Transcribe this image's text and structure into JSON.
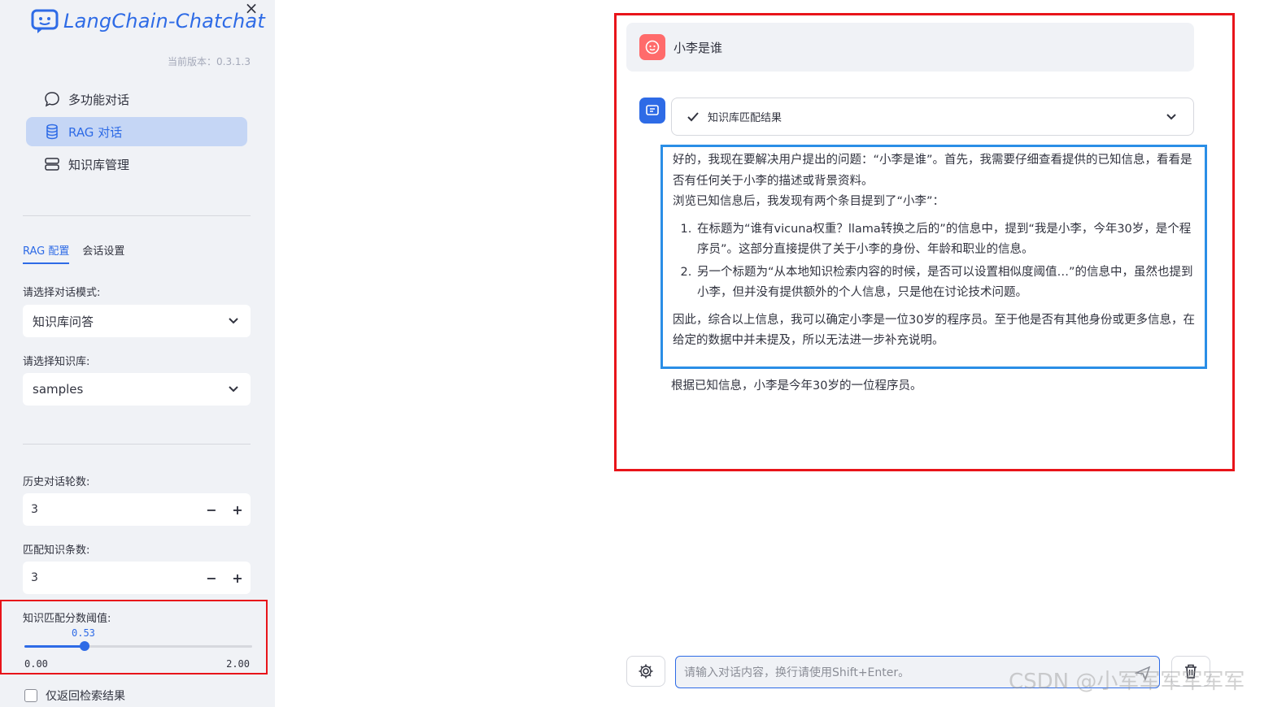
{
  "app": {
    "logo_text": "LangChain-Chatchat",
    "version": "当前版本：0.3.1.3",
    "close_icon": "close-icon"
  },
  "nav": {
    "items": [
      {
        "label": "多功能对话",
        "icon": "chat-bubble-icon",
        "active": false
      },
      {
        "label": "RAG 对话",
        "icon": "database-icon",
        "active": true
      },
      {
        "label": "知识库管理",
        "icon": "server-icon",
        "active": false
      }
    ]
  },
  "tabs": [
    {
      "label": "RAG 配置",
      "active": true
    },
    {
      "label": "会话设置",
      "active": false
    }
  ],
  "config": {
    "mode_label": "请选择对话模式:",
    "mode_value": "知识库问答",
    "kb_label": "请选择知识库:",
    "kb_value": "samples",
    "history_label": "历史对话轮数:",
    "history_value": "3",
    "topk_label": "匹配知识条数:",
    "topk_value": "3",
    "threshold_label": "知识匹配分数阈值:",
    "threshold_value": "0.53",
    "threshold_min": "0.00",
    "threshold_max": "2.00",
    "threshold_fraction": 0.265,
    "checkbox_label": "仅返回检索结果",
    "minus": "−",
    "plus": "+"
  },
  "chat": {
    "user_message": "小李是谁",
    "expander_label": "知识库匹配结果",
    "think": {
      "p1": "好的，我现在要解决用户提出的问题：“小李是谁”。首先，我需要仔细查看提供的已知信息，看看是否有任何关于小李的描述或背景资料。",
      "p2": "浏览已知信息后，我发现有两个条目提到了“小李”：",
      "items": [
        "在标题为“谁有vicuna权重？llama转换之后的”的信息中，提到“我是小李，今年30岁，是个程序员”。这部分直接提供了关于小李的身份、年龄和职业的信息。",
        "另一个标题为“从本地知识检索内容的时候，是否可以设置相似度阈值…”的信息中，虽然也提到小李，但并没有提供额外的个人信息，只是他在讨论技术问题。"
      ],
      "p3": "因此，综合以上信息，我可以确定小李是一位30岁的程序员。至于他是否有其他身份或更多信息，在给定的数据中并未提及，所以无法进一步补充说明。"
    },
    "answer": "根据已知信息，小李是今年30岁的一位程序员。",
    "input_placeholder": "请输入对话内容，换行请使用Shift+Enter。"
  },
  "watermark": "CSDN @小军军军军军军"
}
